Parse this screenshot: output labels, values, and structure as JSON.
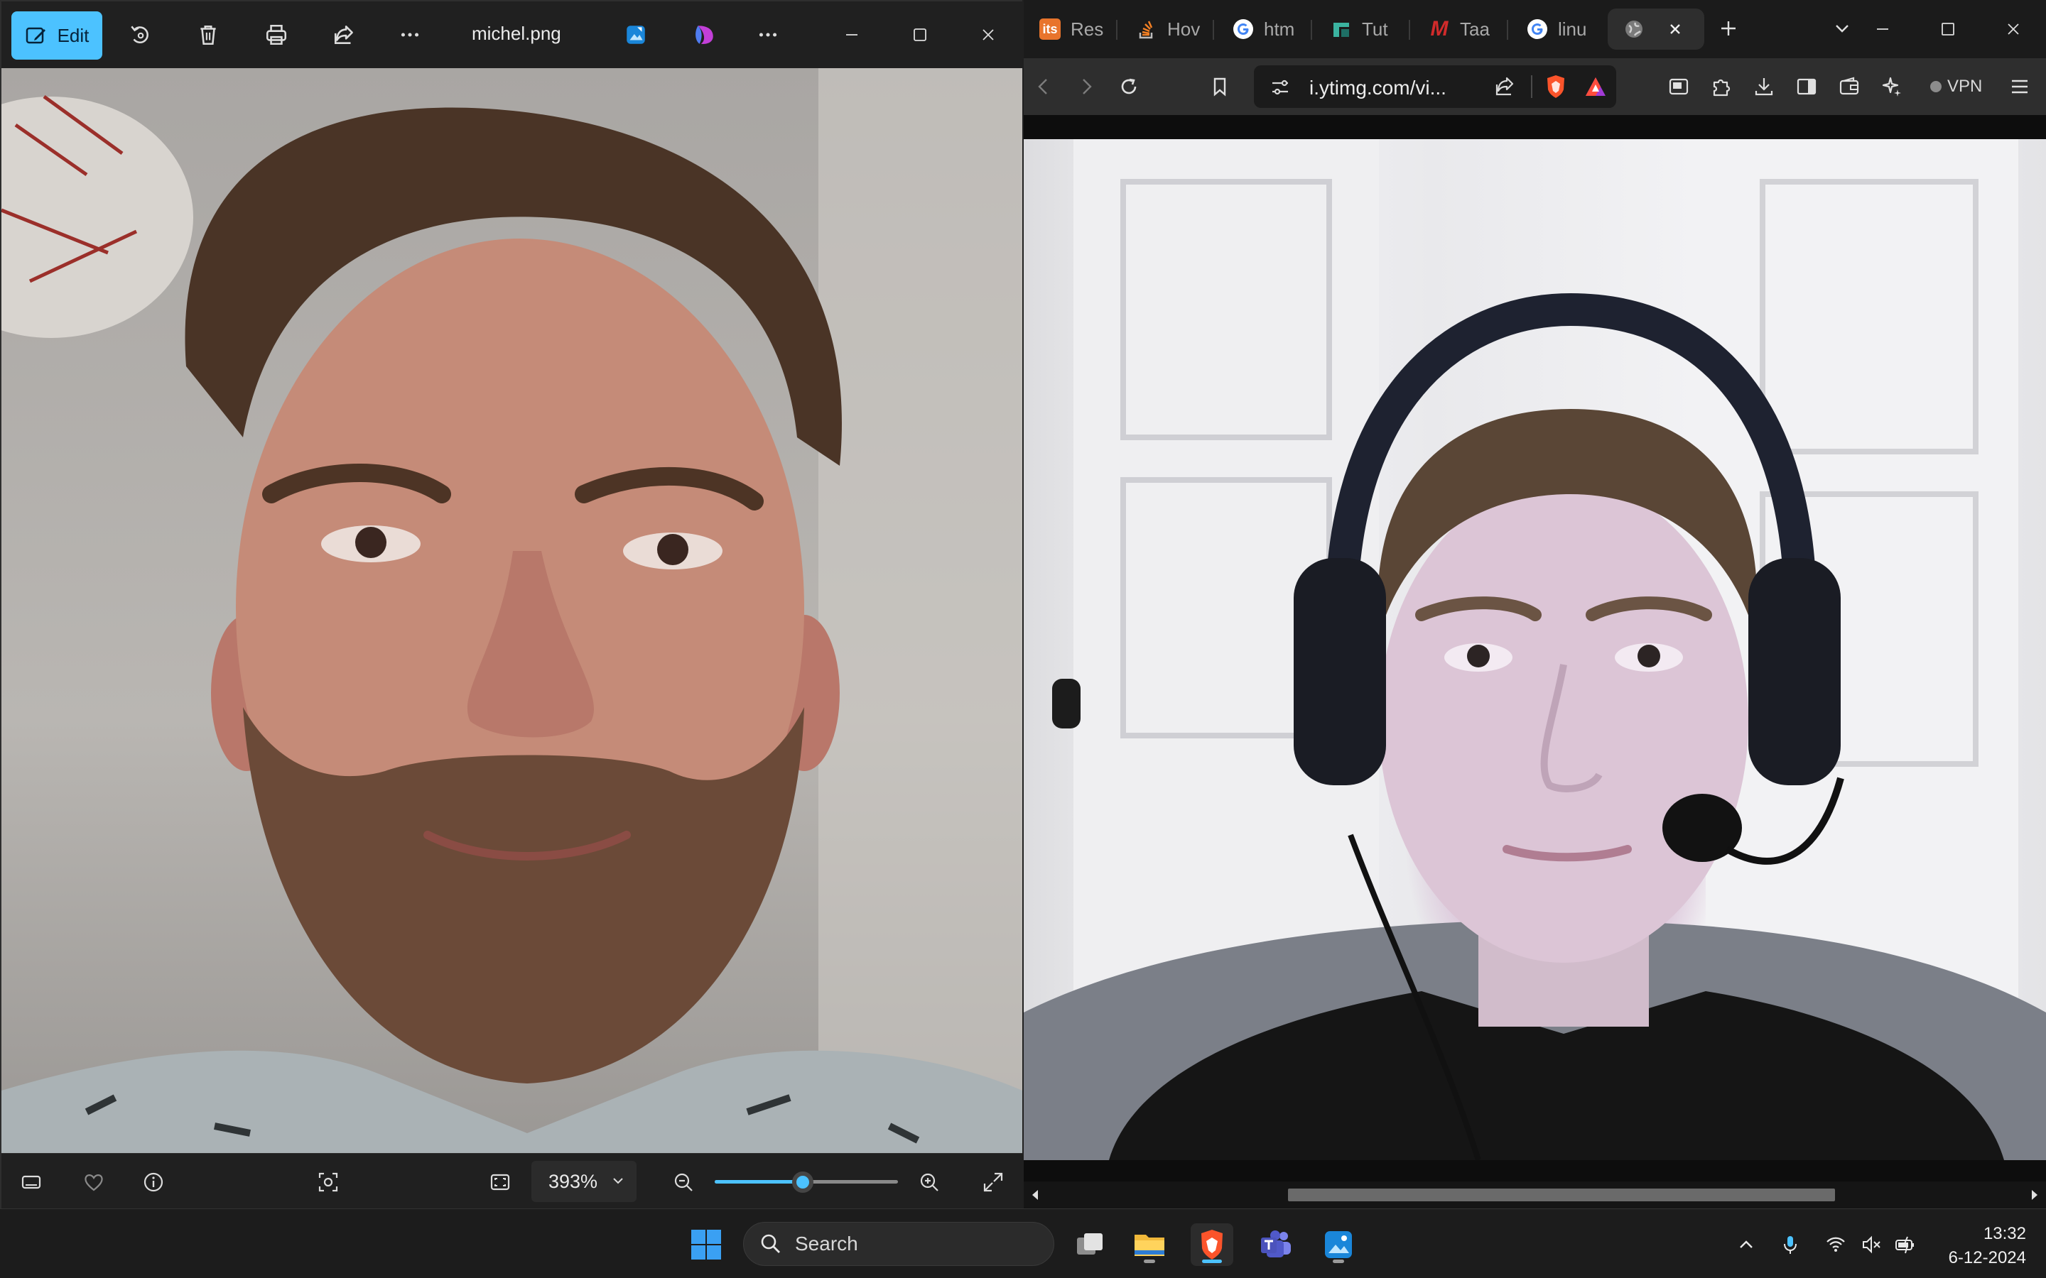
{
  "photos_app": {
    "toolbar": {
      "edit_label": "Edit",
      "filename": "michel.png"
    },
    "footer": {
      "zoom_value": "393%",
      "zoom_level_fraction": 0.48
    }
  },
  "browser": {
    "tabs": [
      {
        "label": "Res",
        "icon": "its-icon",
        "favicon_text": "its",
        "favicon_color": "#e8742c"
      },
      {
        "label": "Hov",
        "icon": "stackoverflow-icon",
        "favicon_color": "#f48024"
      },
      {
        "label": "htm",
        "icon": "google-icon",
        "favicon_color": "#ffffff"
      },
      {
        "label": "Tut",
        "icon": "tut-icon",
        "favicon_color": "#3bb3a0"
      },
      {
        "label": "Taa",
        "icon": "m-icon",
        "favicon_text": "M",
        "favicon_color": "#d12b2b"
      },
      {
        "label": "linu",
        "icon": "google-icon",
        "favicon_color": "#ffffff"
      },
      {
        "label": "",
        "icon": "globe-icon",
        "favicon_color": "#bdbdbd",
        "active": true
      }
    ],
    "address": {
      "url": "i.ytimg.com/vi..."
    },
    "vpn_label": "VPN"
  },
  "taskbar": {
    "search_placeholder": "Search",
    "apps": [
      "windows-start",
      "task-view",
      "file-explorer",
      "brave-browser",
      "teams",
      "photos"
    ],
    "clock": {
      "time": "13:32",
      "date": "6-12-2024"
    }
  },
  "colors": {
    "accent": "#4cc2ff",
    "brave": "#fb542b"
  }
}
